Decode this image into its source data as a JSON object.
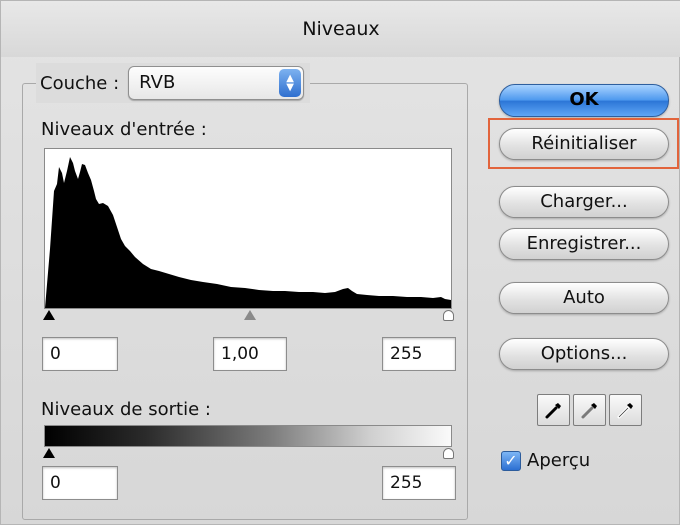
{
  "window": {
    "title": "Niveaux"
  },
  "channel": {
    "label": "Couche :",
    "value": "RVB"
  },
  "input": {
    "label": "Niveaux d'entrée :",
    "black": "0",
    "gamma": "1,00",
    "white": "255"
  },
  "output": {
    "label": "Niveaux de sortie :",
    "black": "0",
    "white": "255"
  },
  "buttons": {
    "ok": "OK",
    "reset": "Réinitialiser",
    "load": "Charger...",
    "save": "Enregistrer...",
    "auto": "Auto",
    "options": "Options..."
  },
  "preview": {
    "label": "Aperçu",
    "checked": true
  },
  "eyedroppers": [
    "black-point-eyedropper-icon",
    "gray-point-eyedropper-icon",
    "white-point-eyedropper-icon"
  ],
  "colors": {
    "accent": "#3b82e0",
    "highlight": "#e2643c"
  }
}
